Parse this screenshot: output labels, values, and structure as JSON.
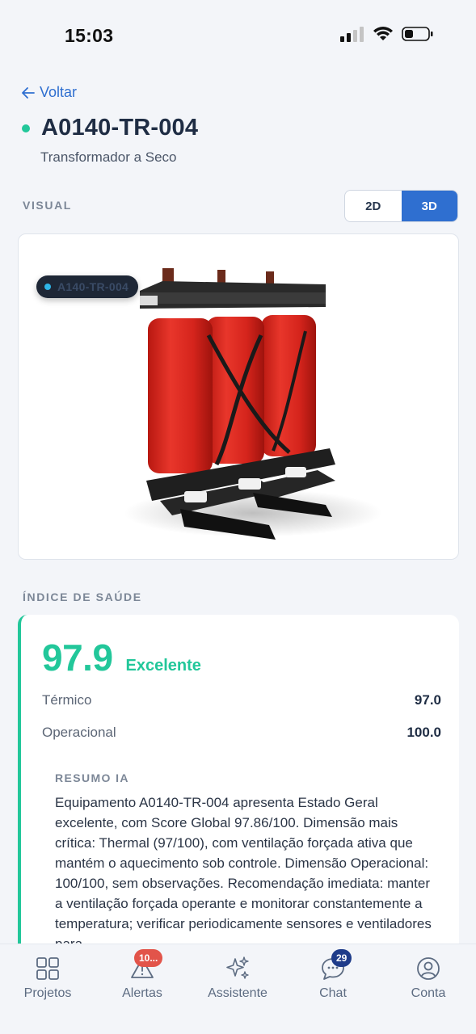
{
  "status_bar": {
    "time": "15:03"
  },
  "header": {
    "back_label": "Voltar",
    "title": "A0140-TR-004",
    "subtitle": "Transformador a Seco"
  },
  "visual": {
    "section_label": "VISUAL",
    "toggle": {
      "option_2d": "2D",
      "option_3d": "3D",
      "selected": "3D"
    },
    "model_tag": "A140-TR-004"
  },
  "health": {
    "section_label": "ÍNDICE DE SAÚDE",
    "score": "97.9",
    "rating": "Excelente",
    "metrics": [
      {
        "name": "Térmico",
        "value": "97.0"
      },
      {
        "name": "Operacional",
        "value": "100.0"
      }
    ],
    "ai_summary_label": "RESUMO IA",
    "ai_summary_text": "Equipamento A0140-TR-004 apresenta Estado Geral excelente, com Score Global 97.86/100. Dimensão mais crítica: Thermal (97/100), com ventilação forçada ativa que mantém o aquecimento sob controle. Dimensão Operacional: 100/100, sem observações. Recomendação imediata: manter a ventilação forçada operante e monitorar constantemente a temperatura; verificar periodicamente sensores e ventiladores para"
  },
  "bottom_nav": {
    "items": [
      {
        "label": "Projetos",
        "icon": "grid-icon"
      },
      {
        "label": "Alertas",
        "icon": "alert-icon",
        "badge": "10..."
      },
      {
        "label": "Assistente",
        "icon": "sparkles-icon"
      },
      {
        "label": "Chat",
        "icon": "chat-icon",
        "badge": "29"
      },
      {
        "label": "Conta",
        "icon": "user-icon"
      }
    ]
  },
  "colors": {
    "accent": "#2f6fd0",
    "success": "#22c79a",
    "alert_badge": "#e2544a",
    "chat_badge": "#1f3c8a",
    "transformer_red": "#d9271f"
  }
}
